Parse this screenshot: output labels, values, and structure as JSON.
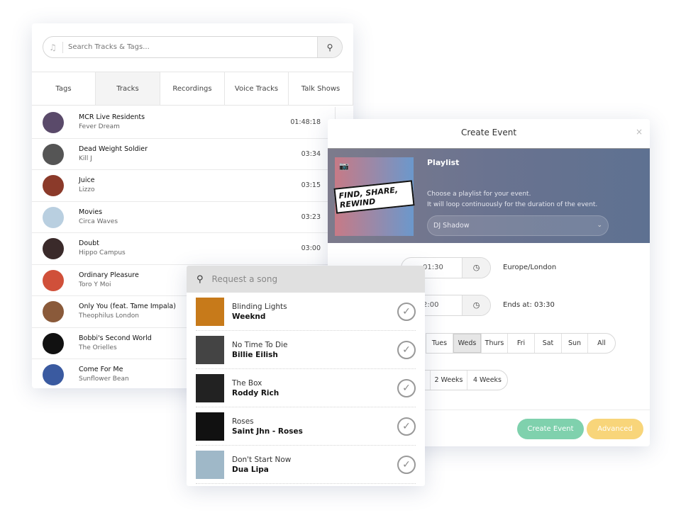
{
  "library": {
    "search_placeholder": "Search Tracks & Tags...",
    "tabs": [
      {
        "label": "Tags"
      },
      {
        "label": "Tracks",
        "active": true
      },
      {
        "label": "Recordings"
      },
      {
        "label": "Voice Tracks"
      },
      {
        "label": "Talk Shows"
      }
    ],
    "tracks": [
      {
        "title": "MCR Live Residents",
        "subtitle": "Fever Dream",
        "duration": "01:48:18",
        "color": "#5a4a6a"
      },
      {
        "title": "Dead Weight Soldier",
        "subtitle": "Kill J",
        "duration": "03:34",
        "color": "#555"
      },
      {
        "title": "Juice",
        "subtitle": "Lizzo",
        "duration": "03:15",
        "color": "#8b3a2a"
      },
      {
        "title": "Movies",
        "subtitle": "Circa Waves",
        "duration": "03:23",
        "color": "#b9cfe0"
      },
      {
        "title": "Doubt",
        "subtitle": "Hippo Campus",
        "duration": "03:00",
        "color": "#3a2a2a"
      },
      {
        "title": "Ordinary Pleasure",
        "subtitle": "Toro Y Moi",
        "duration": "",
        "color": "#d0503a"
      },
      {
        "title": "Only You (feat. Tame Impala)",
        "subtitle": "Theophilus London",
        "duration": "",
        "color": "#8a5a3a"
      },
      {
        "title": "Bobbi's Second World",
        "subtitle": "The Orielles",
        "duration": "",
        "color": "#111"
      },
      {
        "title": "Come For Me",
        "subtitle": "Sunflower Bean",
        "duration": "",
        "color": "#3a5aa0"
      }
    ]
  },
  "modal": {
    "title": "Create Event",
    "close": "×",
    "playlist_label": "Playlist",
    "art_text": "FIND, SHARE, REWIND",
    "description_line1": "Choose a playlist for your event.",
    "description_line2": "It will loop continuously for the duration of the event.",
    "playlist_value": "DJ Shadow",
    "start_time": "01:30",
    "timezone": "Europe/London",
    "end_time": "2:00",
    "ends_at": "Ends at: 03:30",
    "days": [
      {
        "label": "Tues"
      },
      {
        "label": "Weds",
        "active": true
      },
      {
        "label": "Thurs"
      },
      {
        "label": "Fri"
      },
      {
        "label": "Sat"
      },
      {
        "label": "Sun"
      },
      {
        "label": "All"
      }
    ],
    "repeat": [
      {
        "label": "2 Weeks"
      },
      {
        "label": "4 Weeks"
      }
    ],
    "create_label": "Create Event",
    "advanced_label": "Advanced",
    "colors": {
      "create": "#7fd1ad",
      "advanced": "#f8d57a"
    }
  },
  "request": {
    "placeholder": "Request a song",
    "songs": [
      {
        "title": "Blinding Lights",
        "artist": "Weeknd",
        "color": "#c77a1a"
      },
      {
        "title": "No Time To Die",
        "artist": "Billie Eilish",
        "color": "#444"
      },
      {
        "title": "The Box",
        "artist": "Roddy Rich",
        "color": "#222"
      },
      {
        "title": "Roses",
        "artist": "Saint Jhn - Roses",
        "color": "#111"
      },
      {
        "title": "Don't Start Now",
        "artist": "Dua Lipa",
        "color": "#9fb8c8"
      }
    ]
  }
}
